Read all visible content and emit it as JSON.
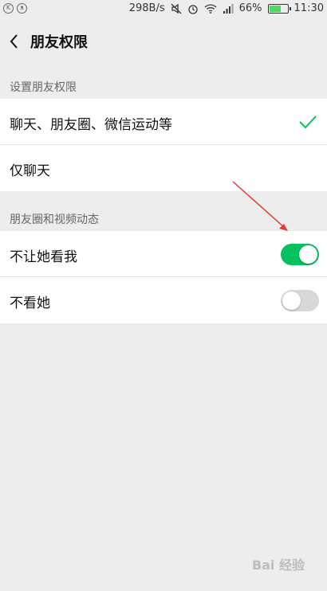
{
  "status_bar": {
    "left_icons": [
      "circle-k-icon",
      "cat-icon"
    ],
    "speed": "298B/s",
    "battery_percent": "66%",
    "battery_level": 0.66,
    "time": "11:30"
  },
  "nav": {
    "title": "朋友权限"
  },
  "section_permissions": {
    "label": "设置朋友权限",
    "items": [
      {
        "label": "聊天、朋友圈、微信运动等",
        "checked": true
      },
      {
        "label": "仅聊天",
        "checked": false
      }
    ]
  },
  "section_moments": {
    "label": "朋友圈和视频动态",
    "items": [
      {
        "label": "不让她看我",
        "toggle": true
      },
      {
        "label": "不看她",
        "toggle": false
      }
    ]
  },
  "colors": {
    "accent": "#07c160",
    "arrow": "#e53935"
  },
  "watermark": "Bai 经验"
}
